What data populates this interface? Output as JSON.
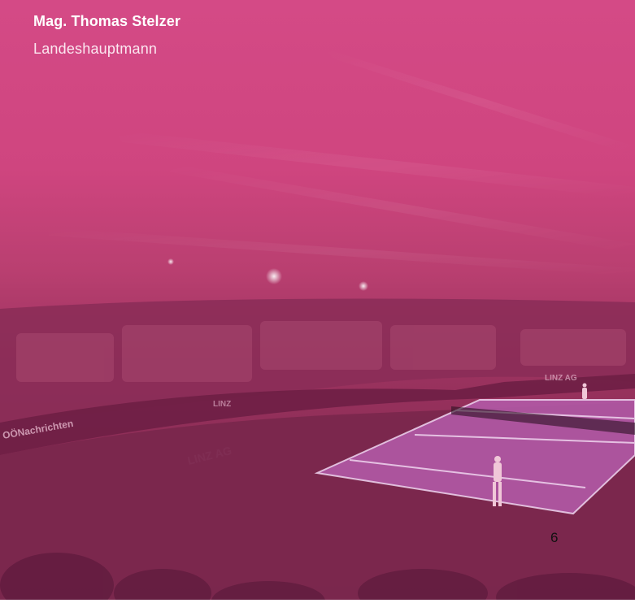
{
  "header": {
    "name": "Mag. Thomas Stelzer",
    "role": "Landeshauptmann"
  },
  "background": {
    "image": "tennis-arena-photo",
    "overlay_color": "#d1467f",
    "banners": [
      "LINZ AG",
      "OÖNachrichten",
      "LINZ",
      "LINZ AG"
    ]
  },
  "footer": {
    "page_number": "6"
  }
}
